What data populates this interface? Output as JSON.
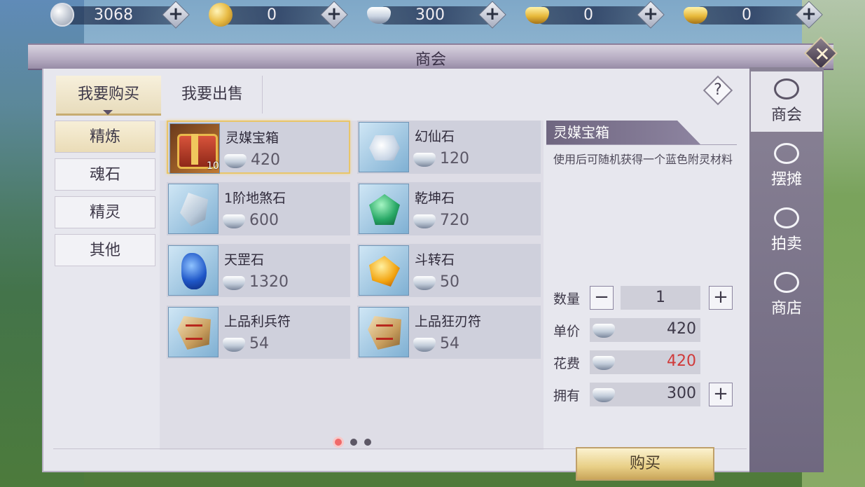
{
  "currencies": [
    {
      "icon": "silver-coin-icon",
      "value": "3068"
    },
    {
      "icon": "gold-coin-icon",
      "value": "0"
    },
    {
      "icon": "silver-ingot-icon",
      "value": "300"
    },
    {
      "icon": "locked-gold-ingot-icon",
      "value": "0"
    },
    {
      "icon": "gold-ingot-icon",
      "value": "0"
    }
  ],
  "window": {
    "title": "商会",
    "close_icon": "close-icon"
  },
  "tabs": {
    "buy": "我要购买",
    "sell": "我要出售",
    "help": "?"
  },
  "categories": [
    "精炼",
    "魂石",
    "精灵",
    "其他"
  ],
  "items": [
    {
      "name": "灵媒宝箱",
      "price": "420",
      "count": "10"
    },
    {
      "name": "幻仙石",
      "price": "120"
    },
    {
      "name": "1阶地煞石",
      "price": "600"
    },
    {
      "name": "乾坤石",
      "price": "720"
    },
    {
      "name": "天罡石",
      "price": "1320"
    },
    {
      "name": "斗转石",
      "price": "50"
    },
    {
      "name": "上品利兵符",
      "price": "54"
    },
    {
      "name": "上品狂刃符",
      "price": "54"
    }
  ],
  "pagination": {
    "pages": 3,
    "current": 1
  },
  "detail": {
    "title": "灵媒宝箱",
    "description": "使用后可随机获得一个蓝色附灵材料",
    "quantity_label": "数量",
    "quantity": "1",
    "unit_price_label": "单价",
    "unit_price": "420",
    "cost_label": "花费",
    "cost": "420",
    "owned_label": "拥有",
    "owned": "300",
    "minus": "−",
    "plus": "+"
  },
  "buy_button": "购买",
  "side_nav": [
    {
      "label": "商会",
      "active": true
    },
    {
      "label": "摆摊",
      "active": false
    },
    {
      "label": "拍卖",
      "active": false
    },
    {
      "label": "商店",
      "active": false
    }
  ],
  "colors": {
    "accent_gold": "#e8c56a",
    "cost_red": "#d03a3a"
  }
}
